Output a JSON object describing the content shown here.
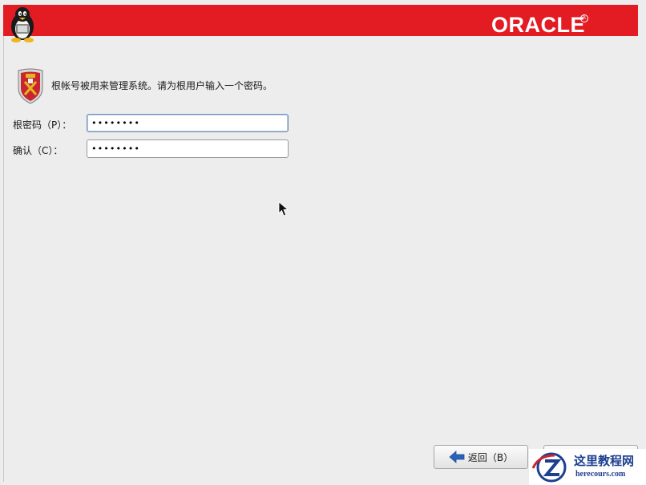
{
  "header": {
    "brand": "ORACLE",
    "brand_mark": "R",
    "brand_color": "#e31b23",
    "left_icon": "tux-penguin-icon"
  },
  "content": {
    "icon": "shield-icon",
    "message": "根帐号被用来管理系统。请为根用户输入一个密码。"
  },
  "form": {
    "root_password_label": "根密码（P）：",
    "root_password_value": "••••••••",
    "confirm_label": "确认（C）：",
    "confirm_value": "••••••••"
  },
  "buttons": {
    "back_label": "返回（B）",
    "back_icon": "arrow-left-icon",
    "next_label": ""
  },
  "watermark": {
    "title": "这里教程网",
    "url": "herecours.com"
  }
}
